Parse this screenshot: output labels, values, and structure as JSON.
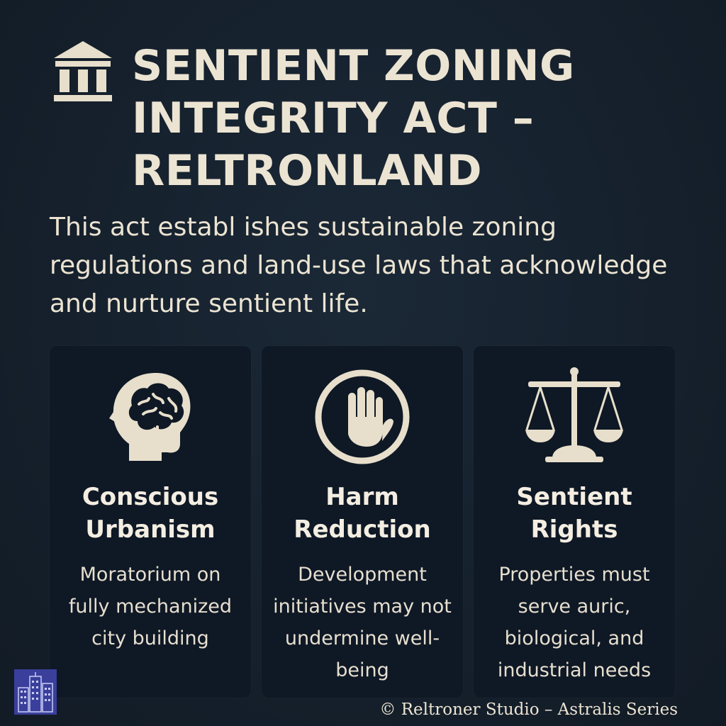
{
  "header": {
    "icon": "courthouse-icon",
    "title": "SENTIENT ZONING INTEGRITY ACT – RELTRONLAND"
  },
  "intro": "This act establ ishes sustainable zoning regulations and land-use laws that acknowledge and nurture sentient life.",
  "cards": [
    {
      "icon": "head-brain-icon",
      "title": "Conscious Urbanism",
      "description": "Moratorium on fully mechanized city building"
    },
    {
      "icon": "stop-hand-icon",
      "title": "Harm Reduction",
      "description": "Development initiatives may not undermine well-being"
    },
    {
      "icon": "scales-icon",
      "title": "Sentient Rights",
      "description": "Properties must serve auric, biological, and industrial needs"
    }
  ],
  "corner_logo": {
    "icon": "city-buildings-icon"
  },
  "footer": "© Reltroner Studio – Astralis Series",
  "colors": {
    "background": "#16212d",
    "card": "#0f1825",
    "accent": "#ece4d2",
    "logo_bg": "#3a3f9c"
  }
}
